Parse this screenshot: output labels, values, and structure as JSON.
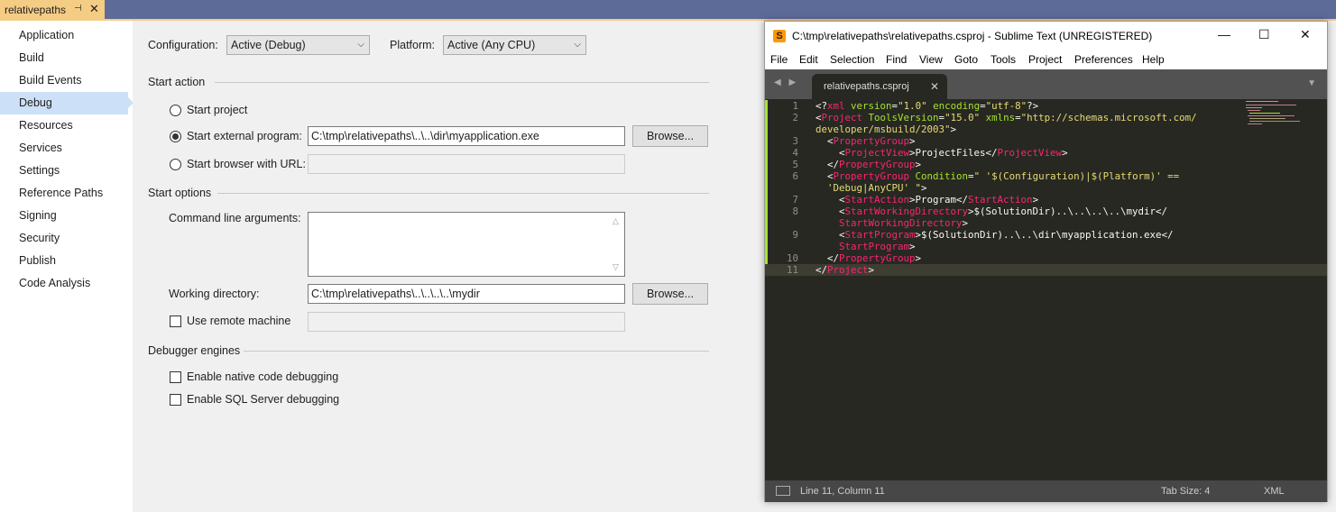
{
  "vs": {
    "tab": {
      "title": "relativepaths",
      "pin": "⊣",
      "close": "✕"
    },
    "nav": [
      "Application",
      "Build",
      "Build Events",
      "Debug",
      "Resources",
      "Services",
      "Settings",
      "Reference Paths",
      "Signing",
      "Security",
      "Publish",
      "Code Analysis"
    ],
    "nav_active": "Debug",
    "config_label": "Configuration:",
    "config_value": "Active (Debug)",
    "platform_label": "Platform:",
    "platform_value": "Active (Any CPU)",
    "start_action": {
      "title": "Start action",
      "start_project": "Start project",
      "start_external": "Start external program:",
      "external_value": "C:\\tmp\\relativepaths\\..\\..\\dir\\myapplication.exe",
      "start_browser": "Start browser with URL:",
      "browse": "Browse...",
      "selected": "start_external"
    },
    "start_options": {
      "title": "Start options",
      "cmd_args_label": "Command line arguments:",
      "workdir_label": "Working directory:",
      "workdir_value": "C:\\tmp\\relativepaths\\..\\..\\..\\..\\mydir",
      "browse": "Browse...",
      "remote_label": "Use remote machine"
    },
    "debugger": {
      "title": "Debugger engines",
      "native": "Enable native code debugging",
      "sql": "Enable SQL Server debugging"
    }
  },
  "sublime": {
    "title": "C:\\tmp\\relativepaths\\relativepaths.csproj - Sublime Text (UNREGISTERED)",
    "logo": "S",
    "win_buttons": {
      "minimize": "—",
      "maximize": "☐",
      "close": "✕"
    },
    "menu": [
      "File",
      "Edit",
      "Selection",
      "Find",
      "View",
      "Goto",
      "Tools",
      "Project",
      "Preferences",
      "Help"
    ],
    "tab": {
      "name": "relativepaths.csproj",
      "close": "✕"
    },
    "tab_nav": "◀ ▶",
    "tab_drop": "▼",
    "line_numbers": [
      "1",
      "2",
      "",
      "3",
      "4",
      "5",
      "6",
      "",
      "7",
      "8",
      "",
      "9",
      "",
      "10",
      "11"
    ],
    "code": [
      [
        [
          "c-w",
          "<?"
        ],
        [
          "c-p",
          "xml"
        ],
        [
          "c-a",
          " version"
        ],
        [
          "c-w",
          "="
        ],
        [
          "c-s",
          "\"1.0\""
        ],
        [
          "c-a",
          " encoding"
        ],
        [
          "c-w",
          "="
        ],
        [
          "c-s",
          "\"utf-8\""
        ],
        [
          "c-w",
          "?>"
        ]
      ],
      [
        [
          "c-w",
          "<"
        ],
        [
          "c-p",
          "Project"
        ],
        [
          "c-a",
          " ToolsVersion"
        ],
        [
          "c-w",
          "="
        ],
        [
          "c-s",
          "\"15.0\""
        ],
        [
          "c-a",
          " xmlns"
        ],
        [
          "c-w",
          "="
        ],
        [
          "c-s",
          "\"http://schemas.microsoft.com/"
        ]
      ],
      [
        [
          "c-s",
          "developer/msbuild/2003\""
        ],
        [
          "c-w",
          ">"
        ]
      ],
      [
        [
          "c-w",
          "  <"
        ],
        [
          "c-p",
          "PropertyGroup"
        ],
        [
          "c-w",
          ">"
        ]
      ],
      [
        [
          "c-w",
          "    <"
        ],
        [
          "c-p",
          "ProjectView"
        ],
        [
          "c-w",
          ">ProjectFiles</"
        ],
        [
          "c-p",
          "ProjectView"
        ],
        [
          "c-w",
          ">"
        ]
      ],
      [
        [
          "c-w",
          "  </"
        ],
        [
          "c-p",
          "PropertyGroup"
        ],
        [
          "c-w",
          ">"
        ]
      ],
      [
        [
          "c-w",
          "  <"
        ],
        [
          "c-p",
          "PropertyGroup"
        ],
        [
          "c-a",
          " Condition"
        ],
        [
          "c-w",
          "="
        ],
        [
          "c-s",
          "\" '$(Configuration)|$(Platform)' =="
        ]
      ],
      [
        [
          "c-s",
          "  'Debug|AnyCPU' \""
        ],
        [
          "c-w",
          ">"
        ]
      ],
      [
        [
          "c-w",
          "    <"
        ],
        [
          "c-p",
          "StartAction"
        ],
        [
          "c-w",
          ">Program</"
        ],
        [
          "c-p",
          "StartAction"
        ],
        [
          "c-w",
          ">"
        ]
      ],
      [
        [
          "c-w",
          "    <"
        ],
        [
          "c-p",
          "StartWorkingDirectory"
        ],
        [
          "c-w",
          ">$(SolutionDir)..\\..\\..\\..\\mydir</"
        ]
      ],
      [
        [
          "c-p",
          "    StartWorkingDirectory"
        ],
        [
          "c-w",
          ">"
        ]
      ],
      [
        [
          "c-w",
          "    <"
        ],
        [
          "c-p",
          "StartProgram"
        ],
        [
          "c-w",
          ">$(SolutionDir)..\\..\\dir\\myapplication.exe</"
        ]
      ],
      [
        [
          "c-p",
          "    StartProgram"
        ],
        [
          "c-w",
          ">"
        ]
      ],
      [
        [
          "c-w",
          "  </"
        ],
        [
          "c-p",
          "PropertyGroup"
        ],
        [
          "c-w",
          ">"
        ]
      ],
      [
        [
          "c-w",
          "</"
        ],
        [
          "c-p",
          "Project"
        ],
        [
          "c-w",
          ">"
        ]
      ]
    ],
    "status": {
      "position": "Line 11, Column 11",
      "tab_size": "Tab Size: 4",
      "syntax": "XML"
    }
  }
}
